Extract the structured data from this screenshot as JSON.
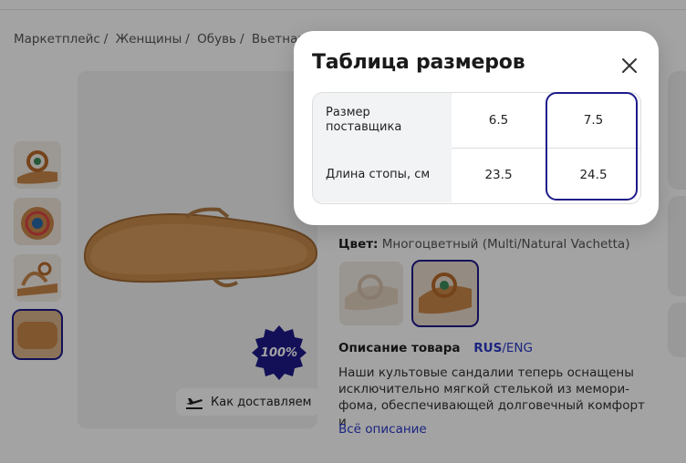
{
  "breadcrumb": [
    "Маркетплейс",
    "Женщины",
    "Обувь",
    "Вьетнамки"
  ],
  "product": {
    "delivery_label": "Как доставляем",
    "badge_text": "100%",
    "color_label": "Цвет:",
    "color_value": "Многоцветный (Multi/Natural Vachetta)",
    "description_title": "Описание товара",
    "lang_rus": "RUS",
    "lang_sep": "/",
    "lang_eng": "ENG",
    "description_text": "Наши культовые сандалии теперь оснащены исключительно мягкой стелькой из мемори-фома, обеспечивающей долговечный комфорт и",
    "all_description": "Всё описание"
  },
  "modal": {
    "title": "Таблица размеров",
    "close_icon": "close-icon",
    "rows": [
      {
        "label": "Размер поставщика",
        "values": [
          "6.5",
          "7.5"
        ]
      },
      {
        "label": "Длина стопы, см",
        "values": [
          "23.5",
          "24.5"
        ]
      }
    ]
  },
  "colors": {
    "accent": "#1f1a8a",
    "link": "#2a39c9",
    "overlay": "rgba(0,0,0,0.36)"
  }
}
